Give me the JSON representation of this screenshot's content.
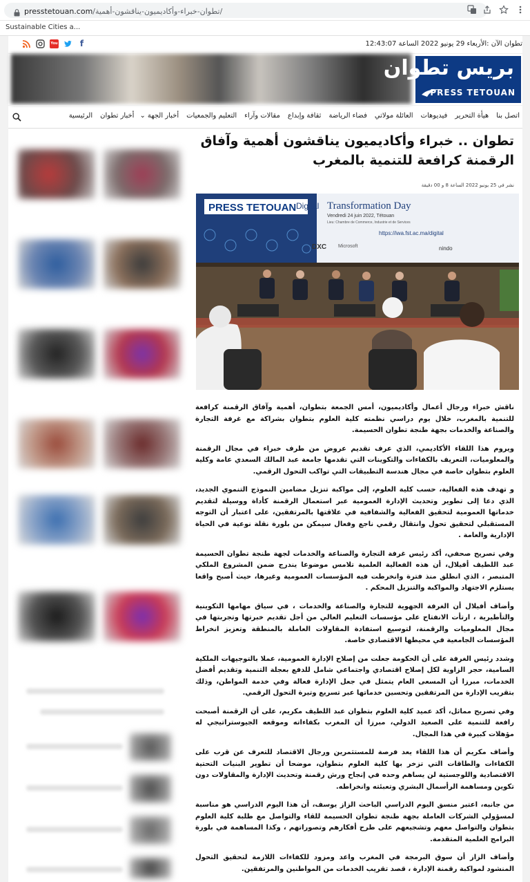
{
  "browser": {
    "url_host": "presstetouan.com",
    "url_path": "/تطوان-خبراء-وأكاديميون-يناقشون-أهمية/",
    "bookmark": "Sustainable Cities a..."
  },
  "topbar": {
    "datetime": "تطوان الآن :الأربعاء 29 يونيو 2022 الساعة 12:43:07",
    "social": [
      "facebook-icon",
      "twitter-icon",
      "youtube-icon",
      "instagram-icon",
      "rss-icon"
    ]
  },
  "logo": {
    "arabic": "بريس تطوان",
    "latin": "PRESS TETOUAN"
  },
  "nav": {
    "items": [
      "الرئيسية",
      "أخبار تطوان",
      "أخبار الجهة",
      "التعليم والجمعيات",
      "مقالات وآراء",
      "ثقافة وإبداع",
      "فضاء الرياضة",
      "العائلة مولاتي",
      "فيديوهات",
      "هيأة التحرير",
      "اتصل بنا"
    ],
    "dropdown_marker": "⌄"
  },
  "article": {
    "title": "تطوان .. خبراء وأكاديميون يناقشون أهمية وآفاق الرقمنة كرافعة للتنمية بالمغرب",
    "meta": "نشر في 25 يونيو 2022 الساعة 8 و 00 دقيقة",
    "photo": {
      "press_label": "PRESS TETOUAN",
      "event_title": "Transformation Day",
      "event_prefix": "Digital",
      "event_date": "Vendredi 24 juin 2022, Tétouan",
      "event_place": "Lieu: Chambre de Commerce, Industrie et de Services",
      "event_url": "https://iwa.fst.ac.ma/digital",
      "sponsors": [
        "DXC",
        "Microsoft",
        "nindo"
      ]
    },
    "paragraphs": [
      "ناقش خبراء ورجال أعمال وأكاديميون، أمس الجمعة بتطوان، أهمية وآفاق الرقمنة كرافعة للتنمية بالمغرب، خلال يوم دراسي نظمته كلية العلوم بتطوان بشراكة مع غرفة التجارة والصناعة والخدمات بجهة طنجة تطوان الحسيمة.",
      "ويروم هذا اللقاء الأكاديمي، الذي عرف تقديم عروض من طرف خبراء في مجال الرقمنة والمعلوميات، التعريف بالكفاءات والتكوينات التي تقدمها جامعة عبد المالك السعدي عامة وكلية العلوم بتطوان خاصة في مجال هندسة التطبيقات التي تواكب التحول الرقمي.",
      "و تهدف هذه الفعالية، حسب كلية العلوم، إلى مواكبة تنزيل مضامين النموذج التنموي الجديد، الذي دعا إلى تطوير وتحديث الإدارة العمومية عبر استعمال الرقمنة كأداة ووسيلة لتقديم خدماتها العمومية لتحقيق الفعالية والشفافية في علاقتها بالمرتفقين، على اعتبار أن التوجه المستقبلي لتحقيق تحول وانتقال رقمي ناجع وفعال سيمكن من بلورة نقلة نوعية في الحياة الإدارية والعامة .",
      "وفي تصريح صحفي، أكد رئيس غرفة التجارة والصناعة والخدمات لجهة طنجة تطوان الحسيمة عبد اللطيف أفيلال، أن هذه الفعالية العلمية تلامس موضوعا يندرج ضمن المشروع الملكي المتبصر ، الذي انطلق منذ فترة وانخرطت فيه المؤسسات العمومية وغيرها، حيث أصبح واقعا يستلزم الاجتهاد والمواكبة والتنزيل المحكم .",
      "وأضاف أفيلال أن الغرفة الجهوية للتجارة والصناعة والخدمات ، في سياق مهامها التكوينية والتأطيرية ، ارتأت الانفتاح على مؤسسات التعليم العالي من أجل تقديم خبرتها وتجربتها في مجال المعلوميات والرقمنة، لتوسيع استفادة المقاولات العاملة بالمنطقة وتعزيز انخراط المؤسسات الجامعية في محيطها الاقتصادي خاصة.",
      "وشدد رئيس الغرفة على أن الحكومة جعلت من إصلاح الإدارة العمومية، عملا بالتوجيهات الملكية السامية، حجر الزاوية لكل إصلاح اقتصادي واجتماعي شامل للدفع بعجلة التنمية وتقديم أفضل الخدمات، مبرزا أن المسعى العام يتمثل في جعل الإدارة فعالة وفي خدمة المواطن، وذلك بتقريب الإدارة من المرتفقين وتحسين خدماتها عبر تسريع وتيرة التحول الرقمي.",
      "وفي تصريح مماثل، أكد عميد كلية العلوم بتطوان عبد اللطيف مكريم، على أن الرقمنة أصبحت رافعة للتنمية على الصعيد الدولي، مبرزا أن المغرب بكفاءاته وموقعه الجيوستراتيجي له مؤهلات كبيرة في هذا المجال.",
      "وأضاف مكريم أن هذا اللقاء يعد فرصة للمستثمرين ورجال الاقتصاد للتعرف عن قرب على الكفاءات والطاقات التي تزخر بها كلية العلوم بتطوان، موضحا أن تطوير البنيات التحتية الاقتصادية واللوجستية لن يساهم وحده في إنجاح ورش رقمنة وتحديث الإدارة والمقاولات دون تكوين ومساهمة الرأسمال البشري وتعبئته وانخراطه.",
      "من جانبه، اعتبر منسق اليوم الدراسي الباحث الزاز يوسف، أن هذا اليوم الدراسي هو مناسبة لمسؤولي الشركات العاملة بجهة طنجة تطوان الحسيمة للقاء والتواصل مع طلبة كلية العلوم بتطوان والتواصل معهم وتشجيعهم على طرح أفكارهم وتصوراتهم ، وكذا المساهمة في بلورة البرامج العلمية المتقدمة.",
      "وأضاف الزاز أن سوق البرمجة في المغرب واعد ومزود للكفاءات اللازمة لتحقيق التحول المنشود لمواكبة رقمنة الإدارة ، قصد تقريب الخدمات من المواطنين والمرتفقين."
    ]
  },
  "colors": {
    "brand_blue": "#0d3a84",
    "facebook": "#3b5998",
    "twitter": "#1da1f2",
    "youtube": "#e52d27",
    "instagram": "#444444",
    "rss": "#f26522"
  }
}
